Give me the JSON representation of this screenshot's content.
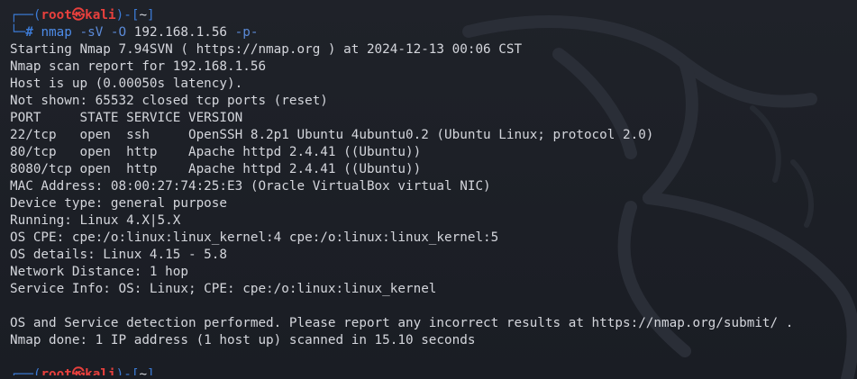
{
  "prompt": {
    "user": "root",
    "at_symbol": "㉿",
    "host": "kali",
    "cwd": "~",
    "symbol": "#"
  },
  "command": {
    "program": "nmap",
    "arg1": "-sV",
    "arg2": "-O",
    "target": "192.168.1.56",
    "arg3": "-p-"
  },
  "output": {
    "lines": [
      "Starting Nmap 7.94SVN ( https://nmap.org ) at 2024-12-13 00:06 CST",
      "Nmap scan report for 192.168.1.56",
      "Host is up (0.00050s latency).",
      "Not shown: 65532 closed tcp ports (reset)",
      "PORT     STATE SERVICE VERSION",
      "22/tcp   open  ssh     OpenSSH 8.2p1 Ubuntu 4ubuntu0.2 (Ubuntu Linux; protocol 2.0)",
      "80/tcp   open  http    Apache httpd 2.4.41 ((Ubuntu))",
      "8080/tcp open  http    Apache httpd 2.4.41 ((Ubuntu))",
      "MAC Address: 08:00:27:74:25:E3 (Oracle VirtualBox virtual NIC)",
      "Device type: general purpose",
      "Running: Linux 4.X|5.X",
      "OS CPE: cpe:/o:linux:linux_kernel:4 cpe:/o:linux:linux_kernel:5",
      "OS details: Linux 4.15 - 5.8",
      "Network Distance: 1 hop",
      "Service Info: OS: Linux; CPE: cpe:/o:linux:linux_kernel",
      "",
      "OS and Service detection performed. Please report any incorrect results at https://nmap.org/submit/ .",
      "Nmap done: 1 IP address (1 host up) scanned in 15.10 seconds",
      ""
    ]
  },
  "colors": {
    "background": "#1f2229",
    "prompt_frame": "#3c7bd6",
    "prompt_user": "#e8403d",
    "command": "#4d8ce8",
    "text": "#d4d6dc"
  },
  "icons": {
    "background": "kali-dragon-watermark-icon"
  }
}
